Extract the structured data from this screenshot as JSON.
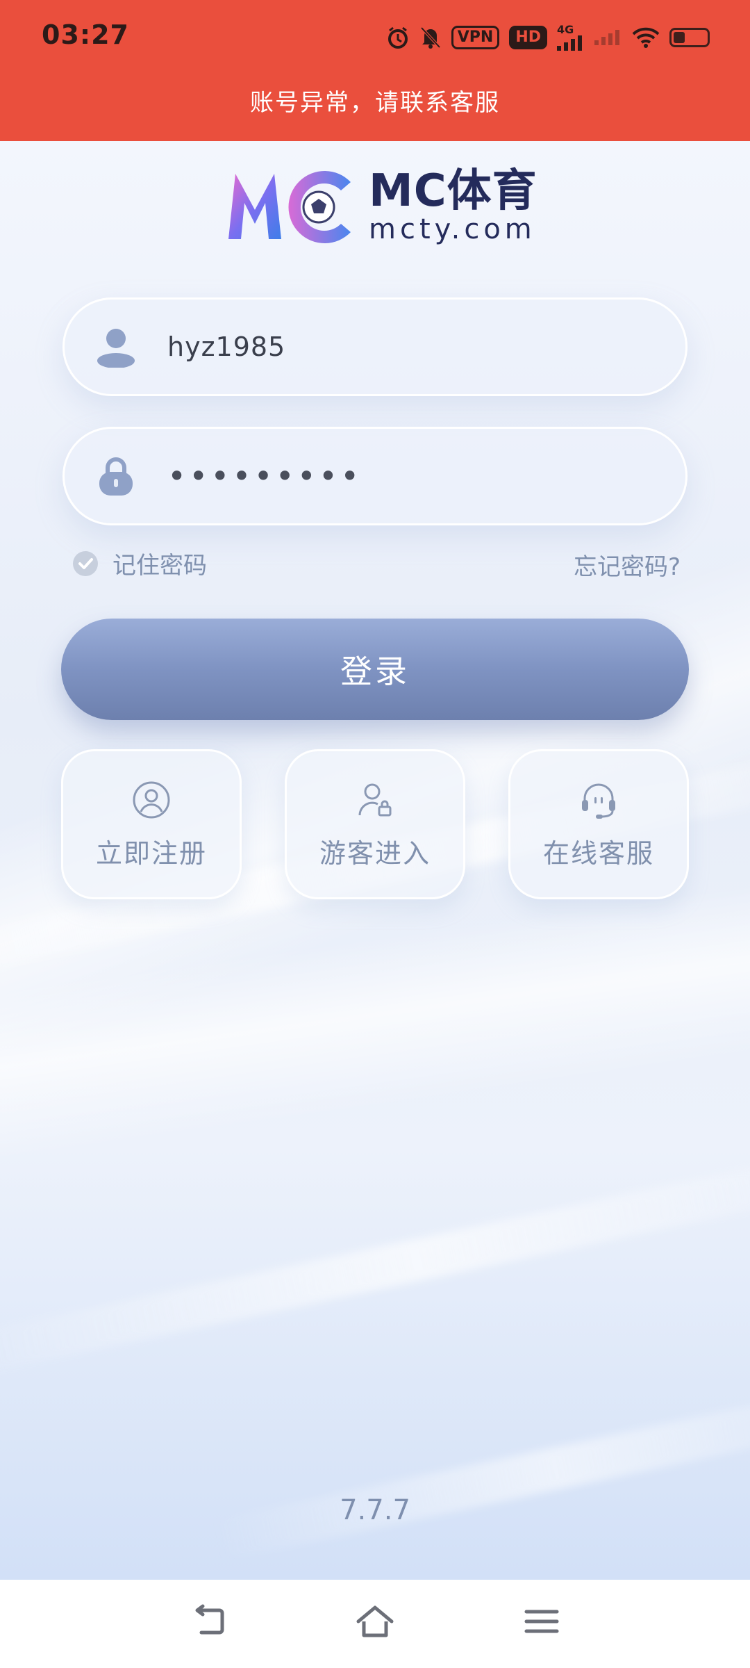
{
  "status_bar": {
    "time": "03:27",
    "icons": [
      "alarm-icon",
      "mute-icon",
      "vpn-icon",
      "hd-icon",
      "signal-4g-icon",
      "signal-weak-icon",
      "wifi-icon",
      "battery-icon"
    ],
    "vpn_label": "VPN",
    "hd_label": "HD",
    "network_label": "4G"
  },
  "alert": {
    "text": "账号异常，请联系客服"
  },
  "logo": {
    "brand": "MC体育",
    "domain": "mcty.com"
  },
  "login_form": {
    "username_value": "hyz1985",
    "password_value": "•••••••••",
    "remember_label": "记住密码",
    "remember_checked": true,
    "forgot_label": "忘记密码?",
    "login_label": "登录"
  },
  "quick_actions": [
    {
      "label": "立即注册",
      "icon": "user-circle-icon"
    },
    {
      "label": "游客进入",
      "icon": "guest-user-icon"
    },
    {
      "label": "在线客服",
      "icon": "headset-icon"
    }
  ],
  "version": "7.7.7",
  "nav_bar": {
    "buttons": [
      "back-icon",
      "home-icon",
      "menu-icon"
    ]
  },
  "colors": {
    "alert_bg": "#ea4f3d",
    "login_button": "#7f93c2",
    "muted_text": "#7f90ae",
    "brand_dark": "#242b5b"
  }
}
